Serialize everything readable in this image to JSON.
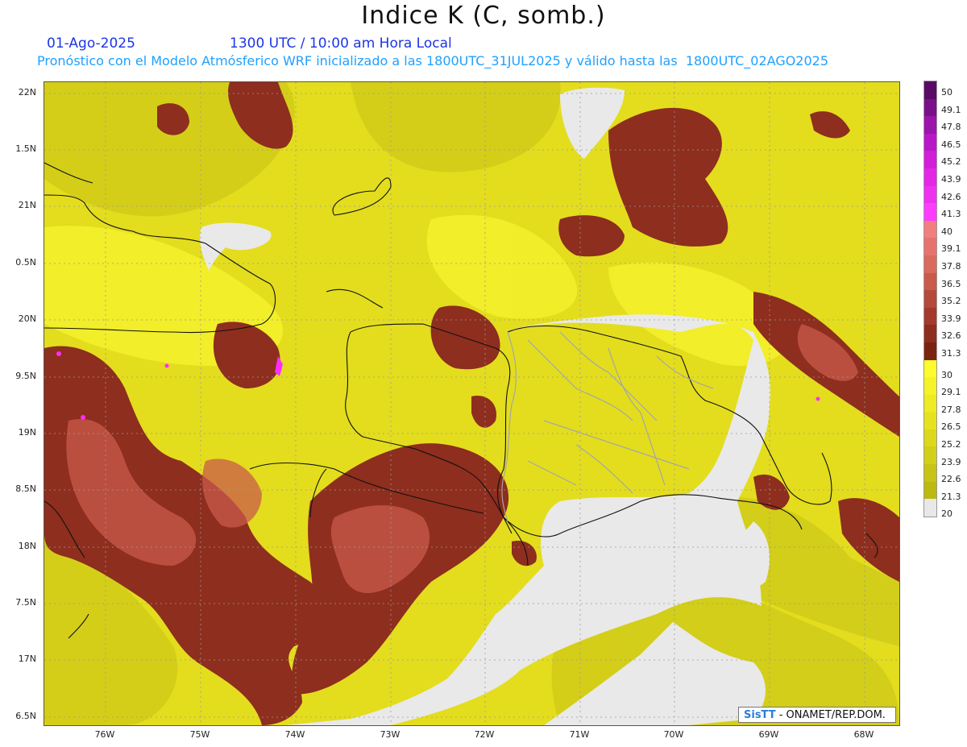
{
  "header": {
    "title": "Indice K (C, somb.)",
    "date": "01-Ago-2025",
    "time": "1300 UTC / 10:00 am Hora Local",
    "description": "Pronóstico con el Modelo Atmósferico WRF inicializado a las 1800UTC_31JUL2025 y válido hasta las  1800UTC_02AGO2025"
  },
  "axes": {
    "lat_labels": [
      "22N",
      "1.5N",
      "21N",
      "0.5N",
      "20N",
      "9.5N",
      "19N",
      "8.5N",
      "18N",
      "7.5N",
      "17N",
      "6.5N"
    ],
    "lon_labels": [
      "76W",
      "75W",
      "74W",
      "73W",
      "72W",
      "71W",
      "70W",
      "69W",
      "68W"
    ]
  },
  "colorbar": {
    "labels": [
      "50",
      "49.1",
      "47.8",
      "46.5",
      "45.2",
      "43.9",
      "42.6",
      "41.3",
      "40",
      "39.1",
      "37.8",
      "36.5",
      "35.2",
      "33.9",
      "32.6",
      "31.3",
      "30",
      "29.1",
      "27.8",
      "26.5",
      "25.2",
      "23.9",
      "22.6",
      "21.3",
      "20"
    ],
    "colors": [
      "#5a0a66",
      "#7a0f8a",
      "#9b14ab",
      "#b818c8",
      "#d21ed8",
      "#e426e6",
      "#f030f0",
      "#ff3cff",
      "#f07f7f",
      "#e6736d",
      "#d96a5e",
      "#c95b4b",
      "#b44a3a",
      "#a33a2a",
      "#8e2e1e",
      "#7a2410",
      "#fdfb2c",
      "#f6f228",
      "#eeea24",
      "#e6e21f",
      "#dcd81c",
      "#d2cf18",
      "#c7c414",
      "#bcb910",
      "#e8e8e8"
    ]
  },
  "credit": {
    "logo": "SisTT",
    "text": " - ONAMET/REP.DOM."
  }
}
